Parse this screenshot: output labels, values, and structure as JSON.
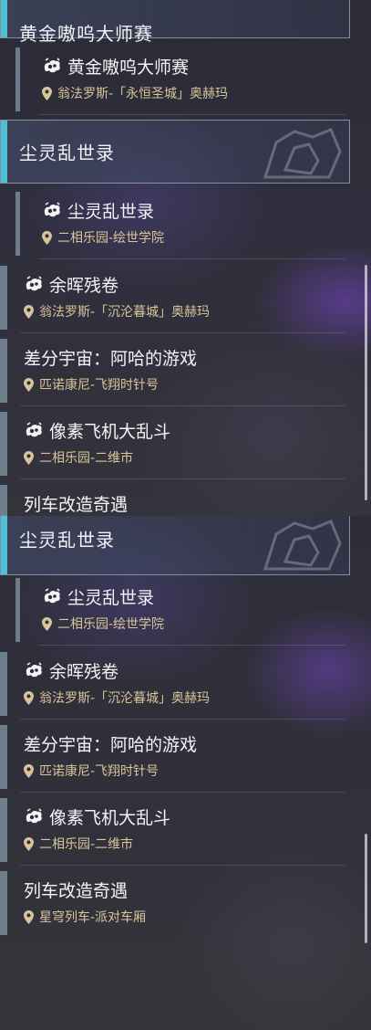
{
  "colors": {
    "accent": "#4ec1d6",
    "location_text": "#d8c59a",
    "title_text": "#f4f4f6"
  },
  "panel_a": {
    "top_header_title": "黄金嗷呜大师赛",
    "top_sub": {
      "name": "黄金嗷呜大师赛",
      "location": "翁法罗斯-「永恒圣城」奥赫玛",
      "icon": "game-paw-icon"
    },
    "header_title": "尘灵乱世录",
    "items": [
      {
        "name": "尘灵乱世录",
        "location": "二相乐园-绘世学院",
        "icon": "game-paw-icon"
      },
      {
        "name": "余晖残卷",
        "location": "翁法罗斯-「沉沦暮城」奥赫玛",
        "icon": "game-paw-icon"
      },
      {
        "name": "差分宇宙：阿哈的游戏",
        "location": "匹诺康尼-飞翔时针号",
        "icon": ""
      },
      {
        "name": "像素飞机大乱斗",
        "location": "二相乐园-二维市",
        "icon": "game-paw-icon"
      },
      {
        "name": "列车改造奇遇",
        "location": "",
        "icon": ""
      }
    ]
  },
  "panel_b": {
    "header_title": "尘灵乱世录",
    "items": [
      {
        "name": "尘灵乱世录",
        "location": "二相乐园-绘世学院",
        "icon": "game-paw-icon"
      },
      {
        "name": "余晖残卷",
        "location": "翁法罗斯-「沉沦暮城」奥赫玛",
        "icon": "game-paw-icon"
      },
      {
        "name": "差分宇宙：阿哈的游戏",
        "location": "匹诺康尼-飞翔时针号",
        "icon": ""
      },
      {
        "name": "像素飞机大乱斗",
        "location": "二相乐园-二维市",
        "icon": "game-paw-icon"
      },
      {
        "name": "列车改造奇遇",
        "location": "星穹列车-派对车厢",
        "icon": ""
      }
    ]
  }
}
